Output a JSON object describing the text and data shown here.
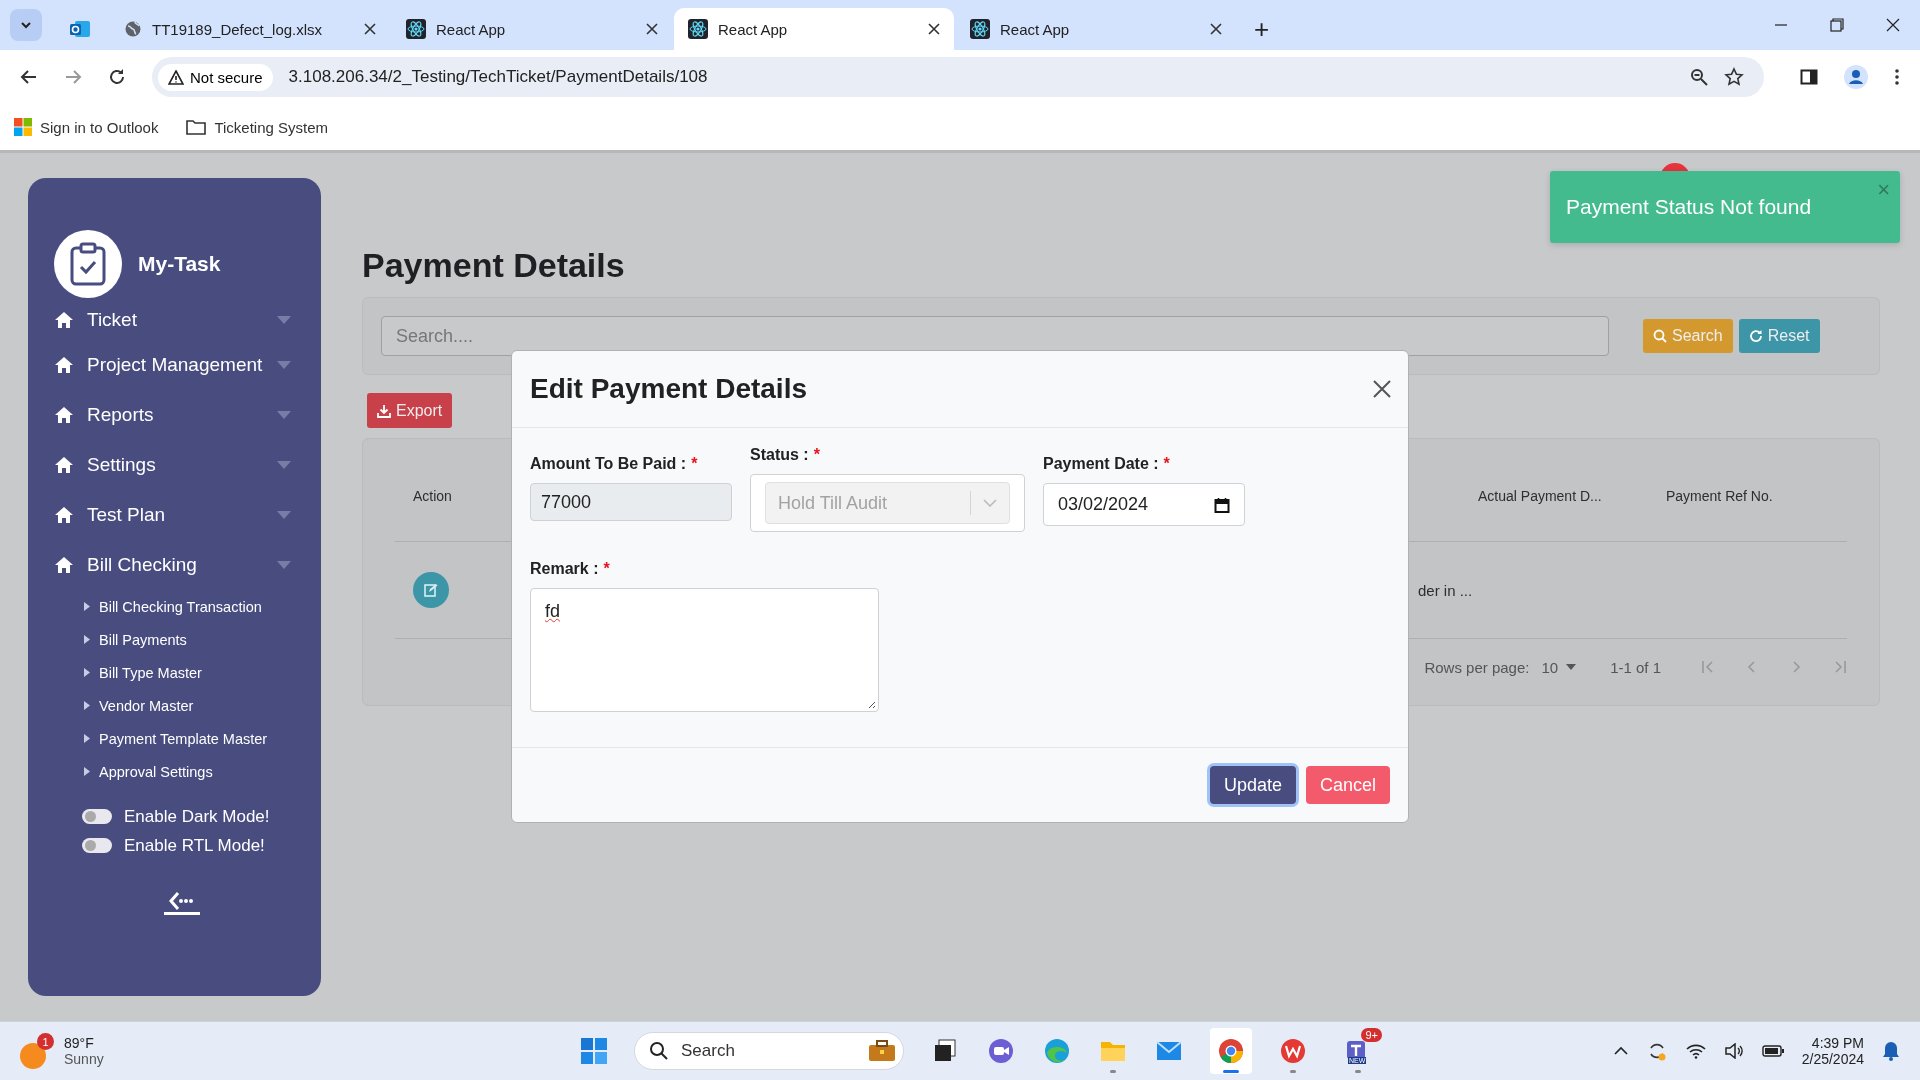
{
  "browser": {
    "tabs": [
      {
        "kind": "outlook",
        "selected": false
      },
      {
        "kind": "globe",
        "title": "TT19189_Defect_log.xlsx",
        "selected": false
      },
      {
        "kind": "react",
        "title": "React App",
        "selected": false
      },
      {
        "kind": "react",
        "title": "React App",
        "selected": true
      },
      {
        "kind": "react",
        "title": "React App",
        "selected": false
      }
    ],
    "new_tab": "+",
    "security": "Not secure",
    "url": "3.108.206.34/2_Testing/TechTicket/PaymentDetails/108",
    "bookmarks": [
      {
        "kind": "windows",
        "label": "Sign in to Outlook"
      },
      {
        "kind": "folder",
        "label": "Ticketing System"
      }
    ]
  },
  "sidebar": {
    "brand": "My-Task",
    "items": [
      {
        "label": "Ticket"
      },
      {
        "label": "Project Management"
      },
      {
        "label": "Reports"
      },
      {
        "label": "Settings"
      },
      {
        "label": "Test Plan"
      },
      {
        "label": "Bill Checking",
        "children": [
          {
            "label": "Bill Checking Transaction"
          },
          {
            "label": "Bill Payments"
          },
          {
            "label": "Bill Type Master"
          },
          {
            "label": "Vendor Master"
          },
          {
            "label": "Payment Template Master"
          },
          {
            "label": "Approval Settings"
          }
        ]
      }
    ],
    "toggles": [
      {
        "label": "Enable Dark Mode!",
        "on": false
      },
      {
        "label": "Enable RTL Mode!",
        "on": false
      }
    ]
  },
  "page": {
    "title": "Payment Details",
    "search": {
      "placeholder": "Search...."
    },
    "search_button": "Search",
    "reset_button": "Reset",
    "export_button": "Export",
    "table": {
      "columns": [
        "Action",
        "Actual Payment D...",
        "Payment Ref No."
      ],
      "rows": [
        {
          "cell": "der in ..."
        }
      ]
    },
    "pagination": {
      "rows_label": "Rows per page:",
      "rows_value": "10",
      "range": "1-1 of 1"
    }
  },
  "toast": {
    "message": "Payment Status Not found",
    "close": "×"
  },
  "modal": {
    "title": "Edit Payment Details",
    "fields": [
      {
        "kind": "text",
        "label": "Amount To Be Paid :",
        "required_mark": "*",
        "value": "77000",
        "disabled": true
      },
      {
        "kind": "select",
        "label": "Status :",
        "required_mark": "*",
        "value": "Hold Till Audit",
        "disabled": true
      },
      {
        "kind": "date",
        "label": "Payment Date :",
        "required_mark": "*",
        "value": "03/02/2024",
        "disabled": false
      }
    ],
    "remark": {
      "label": "Remark :",
      "required_mark": "*",
      "value": "fd"
    },
    "buttons": [
      {
        "kind": "primary",
        "label": "Update"
      },
      {
        "kind": "danger",
        "label": "Cancel"
      }
    ]
  },
  "taskbar": {
    "weather": {
      "badge": "1",
      "temp": "89°F",
      "condition": "Sunny"
    },
    "search": "Search",
    "apps": [
      {
        "kind": "files",
        "running": false,
        "selected": false
      },
      {
        "kind": "meet",
        "running": false,
        "selected": false
      },
      {
        "kind": "edge",
        "running": false,
        "selected": false
      },
      {
        "kind": "folder",
        "running": true,
        "selected": false
      },
      {
        "kind": "mail",
        "running": false,
        "selected": false
      },
      {
        "kind": "chrome",
        "running": true,
        "selected": true
      },
      {
        "kind": "wps",
        "running": true,
        "selected": false
      },
      {
        "kind": "teams",
        "running": true,
        "selected": false,
        "badge": "9+",
        "tag": "NEW"
      }
    ],
    "time": "4:39 PM",
    "date": "2/25/2024"
  }
}
